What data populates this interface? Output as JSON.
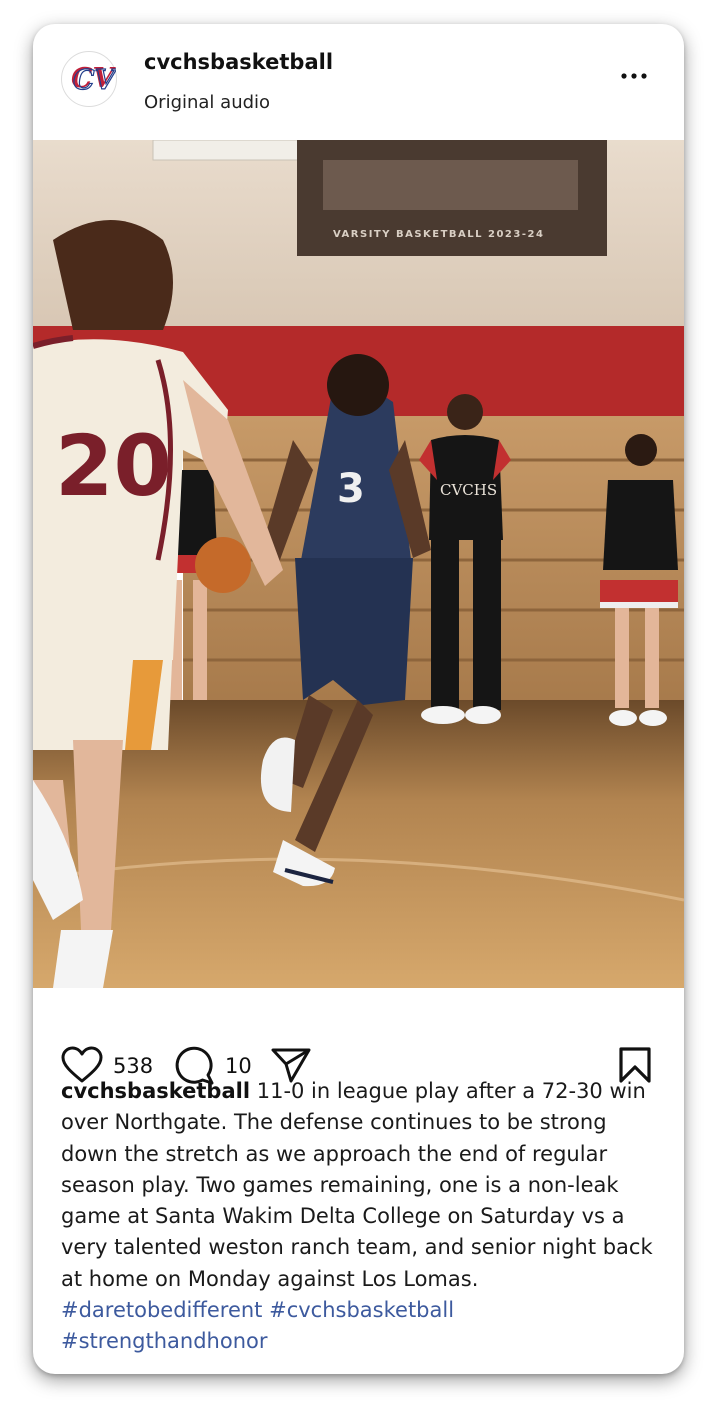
{
  "post": {
    "username": "cvchsbasketball",
    "audio": "Original audio",
    "avatar_text": "CV",
    "like_count": "538",
    "comment_count": "10",
    "caption": {
      "username": "cvchsbasketball",
      "text": "11-0 in league play after a 72-30 win over Northgate. The defense continues to be strong down the stretch as we approach the end of regular season play. Two games remaining, one is a non-leak game at Santa Wakim Delta College on Saturday vs a very talented weston ranch team, and senior night back at home on Monday against Los Lomas."
    },
    "hashtags": [
      "#daretobedifferent",
      "#cvchsbasketball",
      "#strengthandhonor"
    ]
  },
  "media": {
    "banner_text": "VARSITY BASKETBALL 2023-24",
    "jersey_white_number": "20",
    "jersey_navy_number": "3",
    "cheer_shirt_text": "CVCHS"
  },
  "icons": {
    "more": "more-horizontal-icon",
    "like": "heart-icon",
    "comment": "comment-bubble-icon",
    "share": "paper-plane-icon",
    "save": "bookmark-icon"
  },
  "colors": {
    "hashtag": "#3d5a9e",
    "logo_red": "#c0203a",
    "logo_blue": "#233e8b"
  }
}
